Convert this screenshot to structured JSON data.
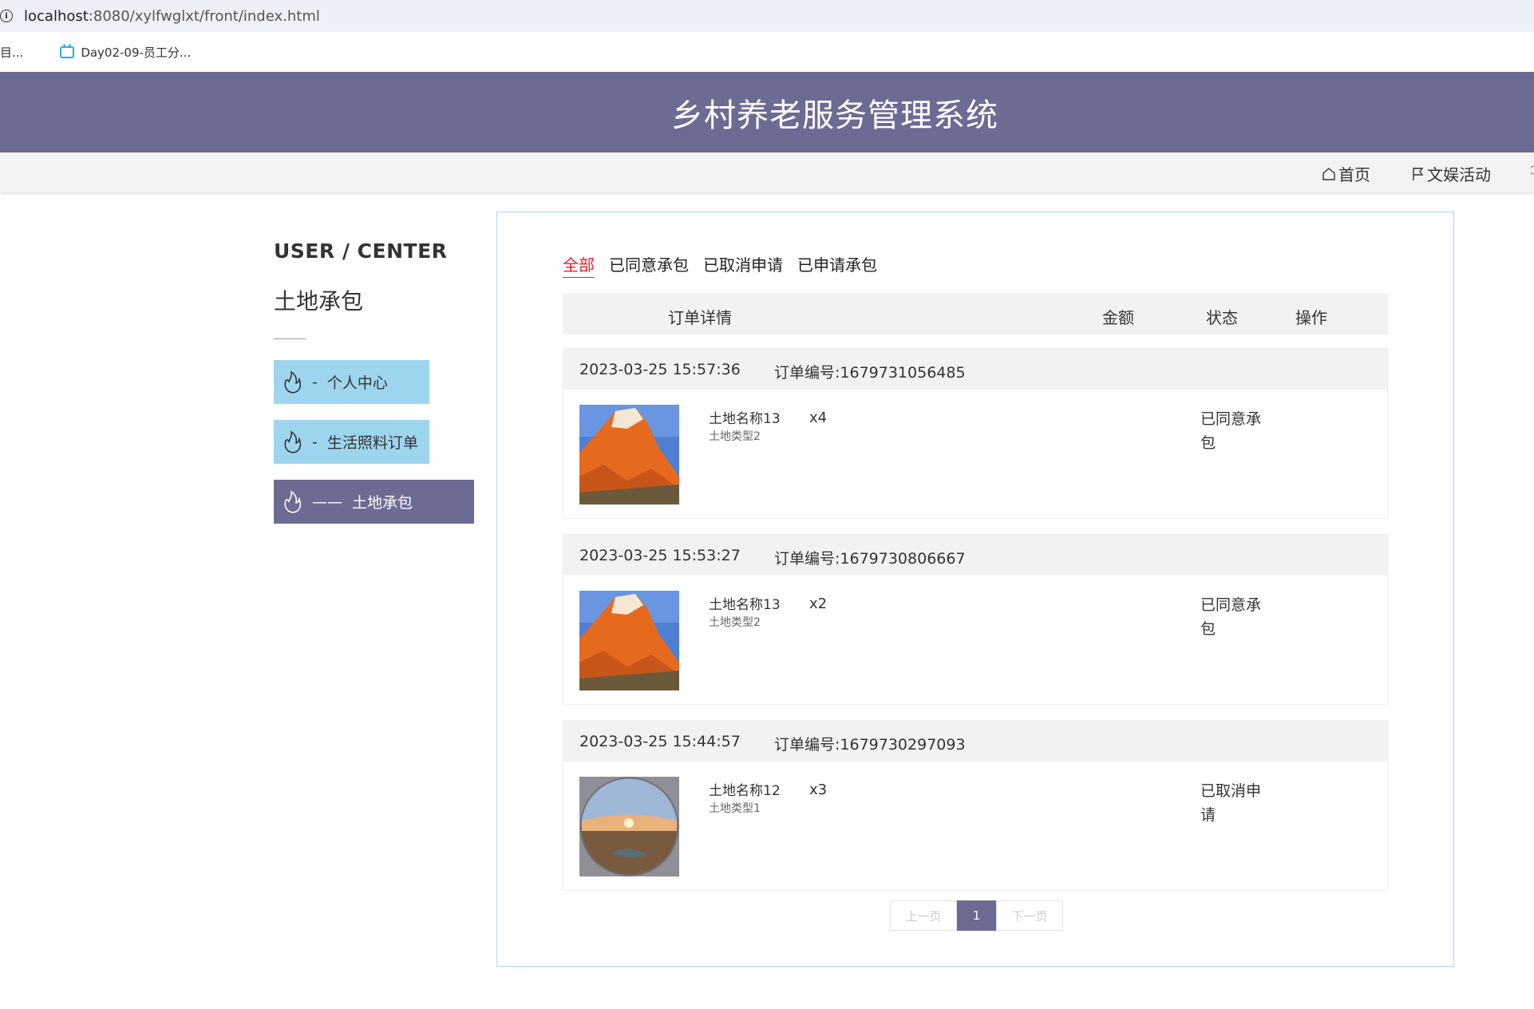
{
  "browser": {
    "url_host": "localhost",
    "url_path": ":8080/xylfwglxt/front/index.html",
    "bookmarks": [
      "目...",
      "Day02-09-员工分..."
    ]
  },
  "header": {
    "title": "乡村养老服务管理系统"
  },
  "nav": {
    "items": [
      "首页",
      "文娱活动"
    ]
  },
  "sidebar": {
    "title": "USER / CENTER",
    "subtitle": "土地承包",
    "items": [
      {
        "label": "个人中心",
        "dash": "-"
      },
      {
        "label": "生活照料订单",
        "dash": "-"
      },
      {
        "label": "土地承包",
        "dash": "——"
      }
    ]
  },
  "tabs": [
    "全部",
    "已同意承包",
    "已取消申请",
    "已申请承包"
  ],
  "table_headers": {
    "detail": "订单详情",
    "amount": "金额",
    "status": "状态",
    "operation": "操作"
  },
  "orders": [
    {
      "time": "2023-03-25 15:57:36",
      "order_no": "订单编号:1679731056485",
      "name": "土地名称13",
      "type": "土地类型2",
      "qty": "x4",
      "status": "已同意承包"
    },
    {
      "time": "2023-03-25 15:53:27",
      "order_no": "订单编号:1679730806667",
      "name": "土地名称13",
      "type": "土地类型2",
      "qty": "x2",
      "status": "已同意承包"
    },
    {
      "time": "2023-03-25 15:44:57",
      "order_no": "订单编号:1679730297093",
      "name": "土地名称12",
      "type": "土地类型1",
      "qty": "x3",
      "status": "已取消申请"
    }
  ],
  "pager": {
    "prev": "上一页",
    "current": "1",
    "next": "下一页"
  },
  "colors": {
    "primary": "#6c6b93",
    "light_menu": "#9dd5ef",
    "tab_active": "#e5202a",
    "panel_border": "#a8d8ee"
  }
}
